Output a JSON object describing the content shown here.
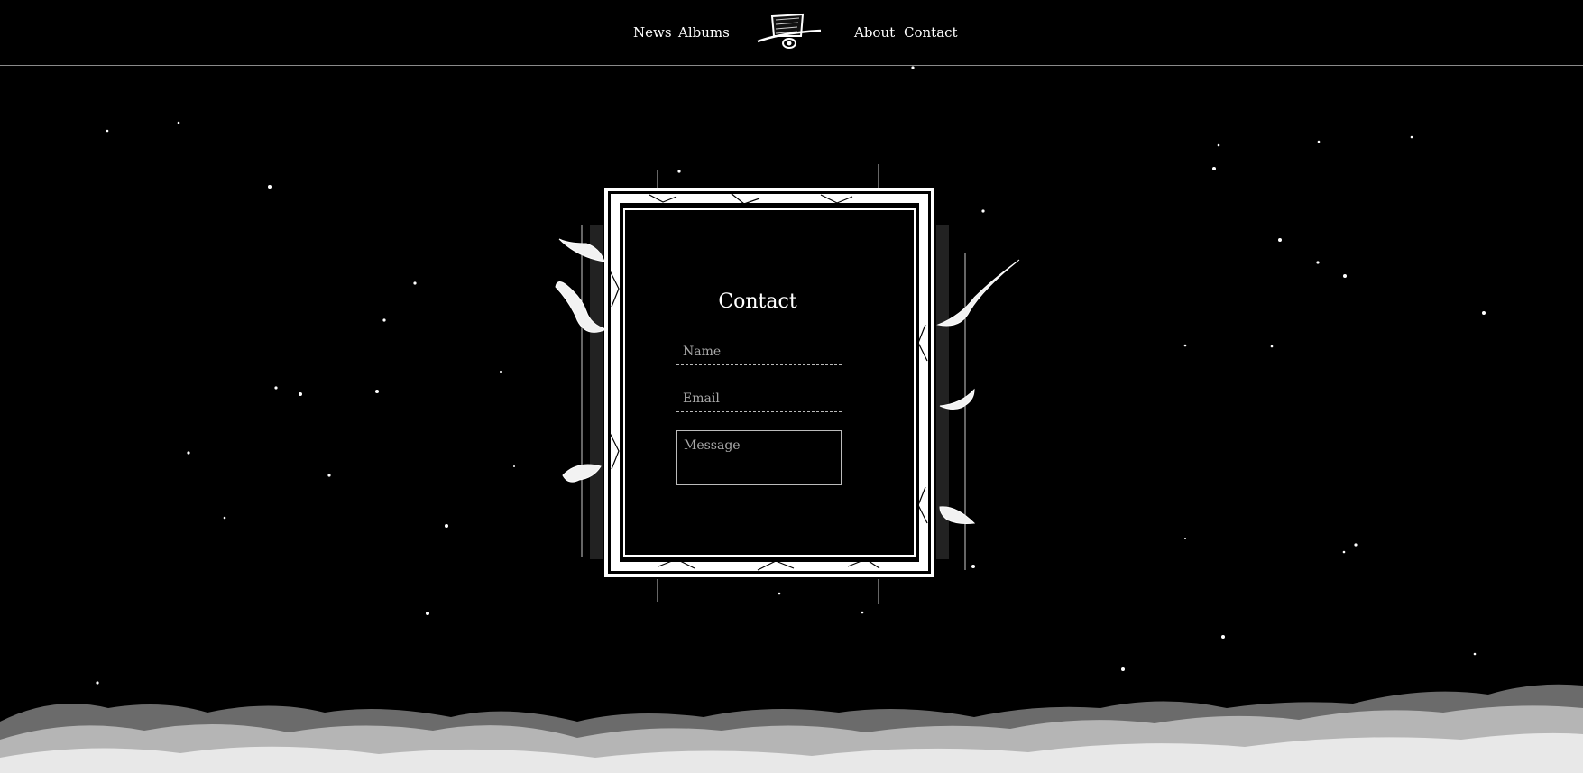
{
  "nav": {
    "news": "News",
    "albums": "Albums",
    "about": "About",
    "contact": "Contact",
    "logo_icon": "top-hat-logo-icon"
  },
  "contact_form": {
    "title": "Contact",
    "name_placeholder": "Name",
    "email_placeholder": "Email",
    "message_placeholder": "Message"
  },
  "colors": {
    "background": "#000000",
    "text": "#ffffff",
    "placeholder": "#a9a9a9",
    "divider": "#8a8a8a"
  }
}
